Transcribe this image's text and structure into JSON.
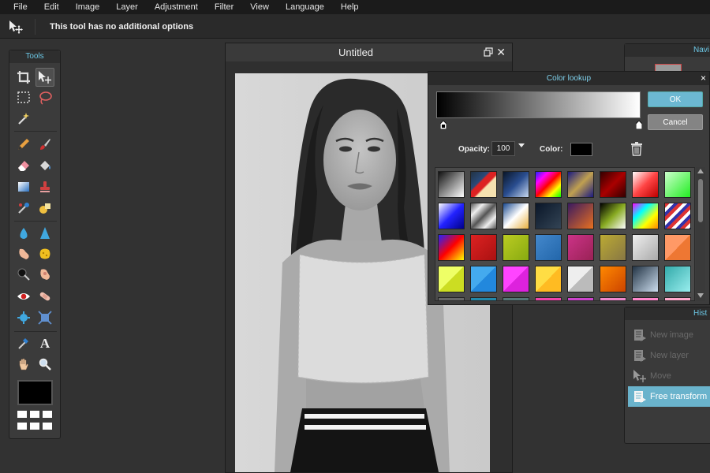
{
  "menu": [
    "File",
    "Edit",
    "Image",
    "Layer",
    "Adjustment",
    "Filter",
    "View",
    "Language",
    "Help"
  ],
  "options_bar": {
    "message": "This tool has no additional options"
  },
  "tools_panel": {
    "title": "Tools"
  },
  "document": {
    "title": "Untitled"
  },
  "navigator": {
    "title": "Navi"
  },
  "history": {
    "title": "Hist",
    "items": [
      "New image",
      "New layer",
      "Move",
      "Free transform"
    ],
    "active_index": 3
  },
  "color_lookup": {
    "title": "Color lookup",
    "ok_label": "OK",
    "cancel_label": "Cancel",
    "opacity_label": "Opacity:",
    "opacity_value": "100",
    "color_label": "Color:",
    "color_value": "#000000",
    "close_glyph": "×"
  },
  "colors": {
    "accent": "#6cb8d2",
    "panel": "#3b3b3b",
    "background": "#323232"
  }
}
